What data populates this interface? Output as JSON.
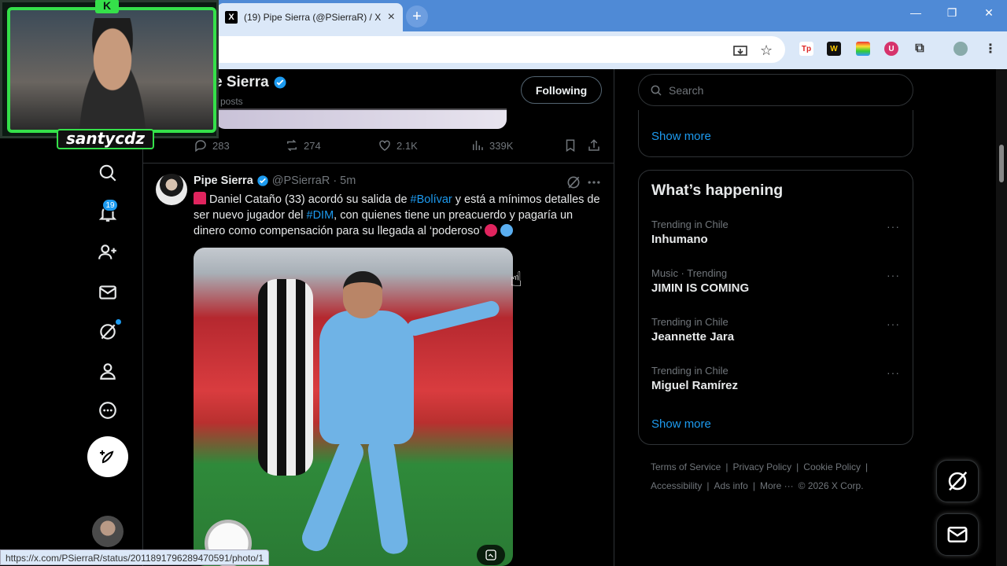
{
  "browser": {
    "tab_title": "(19) Pipe Sierra (@PSierraR) / X",
    "tab_favicon": "X",
    "new_tab": "+",
    "status_url": "https://x.com/PSierraR/status/2011891796289470591/photo/1",
    "extensions": [
      "Tp",
      "W",
      "U"
    ]
  },
  "overlay": {
    "streamer_name": "santycdz",
    "badge": "K"
  },
  "nav": {
    "notification_count": "19"
  },
  "profile_header": {
    "name": "e Sierra",
    "subtitle": "posts",
    "following_label": "Following"
  },
  "prev_actions": {
    "replies": "283",
    "reposts": "274",
    "likes": "2.1K",
    "views": "339K"
  },
  "tweet": {
    "name": "Pipe Sierra",
    "handle": "@PSierraR",
    "time": "· 5m",
    "text_1": " Daniel Cataño (33) acordó su salida de ",
    "tag_1": "#Bolívar",
    "text_2": " y está a mínimos detalles de ser nuevo jugador del ",
    "tag_2": "#DIM",
    "text_3": ", con quienes tiene un preacuerdo y pagaría un dinero como compensación para su llegada al ‘poderoso’ ",
    "dot_colors": [
      "#e0245e",
      "#5aaef0"
    ]
  },
  "right": {
    "search_placeholder": "Search",
    "show_more_1": "Show more",
    "whats_happening": "What’s happening",
    "trends": [
      {
        "meta": "Trending in Chile",
        "name": "Inhumano"
      },
      {
        "meta": "Music · Trending",
        "name": "JIMIN IS COMING"
      },
      {
        "meta": "Trending in Chile",
        "name": "Jeannette Jara"
      },
      {
        "meta": "Trending in Chile",
        "name": "Miguel Ramírez"
      }
    ],
    "show_more_2": "Show more",
    "footer_row1": [
      "Terms of Service",
      "Privacy Policy",
      "Cookie Policy"
    ],
    "footer_row2": [
      "Accessibility",
      "Ads info",
      "More ···",
      "© 2026 X Corp."
    ]
  },
  "colors": {
    "accent": "#1d9bf0",
    "overlay_green": "#35e04a",
    "background": "#000000"
  }
}
